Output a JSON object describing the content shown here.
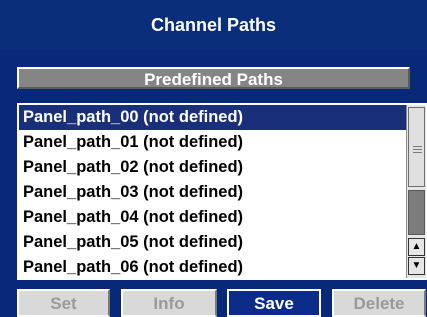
{
  "window": {
    "title": "Channel Paths"
  },
  "section": {
    "title": "Predefined Paths"
  },
  "list": {
    "items": [
      {
        "label": "Panel_path_00 (not defined)",
        "selected": true
      },
      {
        "label": "Panel_path_01 (not defined)",
        "selected": false
      },
      {
        "label": "Panel_path_02 (not defined)",
        "selected": false
      },
      {
        "label": "Panel_path_03 (not defined)",
        "selected": false
      },
      {
        "label": "Panel_path_04 (not defined)",
        "selected": false
      },
      {
        "label": "Panel_path_05 (not defined)",
        "selected": false
      },
      {
        "label": "Panel_path_06 (not defined)",
        "selected": false
      }
    ]
  },
  "buttons": {
    "set": "Set",
    "info": "Info",
    "save": "Save",
    "delete": "Delete"
  },
  "colors": {
    "title_bar": "#0b2e7a",
    "panel_bg": "#08287a",
    "selection": "#1a2f7a",
    "primary_button": "#0d2c8a",
    "disabled_button": "#d9d9d9"
  },
  "icons": {
    "scroll_up": "triangle-up-icon",
    "scroll_down": "triangle-down-icon"
  }
}
